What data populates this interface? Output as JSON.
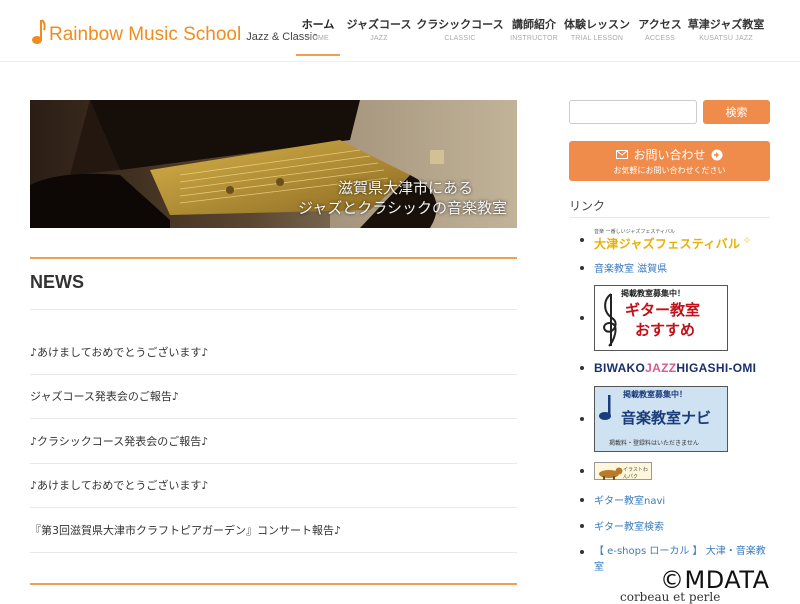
{
  "header": {
    "logo_text": "Rainbow Music School",
    "logo_sub": "Jazz & Classic",
    "nav": [
      {
        "label": "ホーム",
        "sub": "HOME"
      },
      {
        "label": "ジャズコース",
        "sub": "JAZZ"
      },
      {
        "label": "クラシックコース",
        "sub": "CLASSIC"
      },
      {
        "label": "講師紹介",
        "sub": "INSTRUCTOR"
      },
      {
        "label": "体験レッスン",
        "sub": "TRIAL LESSON"
      },
      {
        "label": "アクセス",
        "sub": "ACCESS"
      },
      {
        "label": "草津ジャズ教室",
        "sub": "KUSATSU JAZZ"
      }
    ]
  },
  "hero": {
    "line1": "滋賀県大津市にある",
    "line2": "ジャズとクラシックの音楽教室"
  },
  "news": {
    "title": "NEWS",
    "items": [
      "♪あけましておめでとうございます♪",
      "ジャズコース発表会のご報告♪",
      "♪クラシックコース発表会のご報告♪",
      "♪あけましておめでとうございます♪",
      "『第3回滋賀県大津市クラフトピアガーデン』コンサート報告♪"
    ]
  },
  "sidebar": {
    "search_placeholder": "",
    "search_button": "検索",
    "contact_main": "お問い合わせ",
    "contact_sub": "お気軽にお問い合わせください",
    "links_title": "リンク",
    "links": {
      "jazzfest_small": "音楽 一番しいジャズフェスティバル",
      "jazzfest_big": "大津ジャズフェスティバル",
      "ongaku_shiga": "音楽教室 滋賀県",
      "guitar_banner_top": "掲載教室募集中！",
      "guitar_banner_line1": "ギター教室",
      "guitar_banner_line2": "おすすめ",
      "biwako_a": "BIWAKO",
      "biwako_b": "JAZZ",
      "biwako_c": "HIGASHI-OMI",
      "onkyo_top": "掲載教室募集中！",
      "onkyo_main": "音楽教室ナビ",
      "onkyo_sub": "掲載料・登録料はいただきません",
      "dog_banner": "イラストわんパク",
      "guitar_navi": "ギター教室navi",
      "guitar_search": "ギター教室検索",
      "eshops": "【 e-shops ローカル 】 大津・音楽教室",
      "bottom": "corbeau et perle"
    }
  },
  "watermark": "©MDATA",
  "colors": {
    "accent": "#f08c4b",
    "link": "#3a7bbf",
    "logo": "#f08c1e"
  }
}
